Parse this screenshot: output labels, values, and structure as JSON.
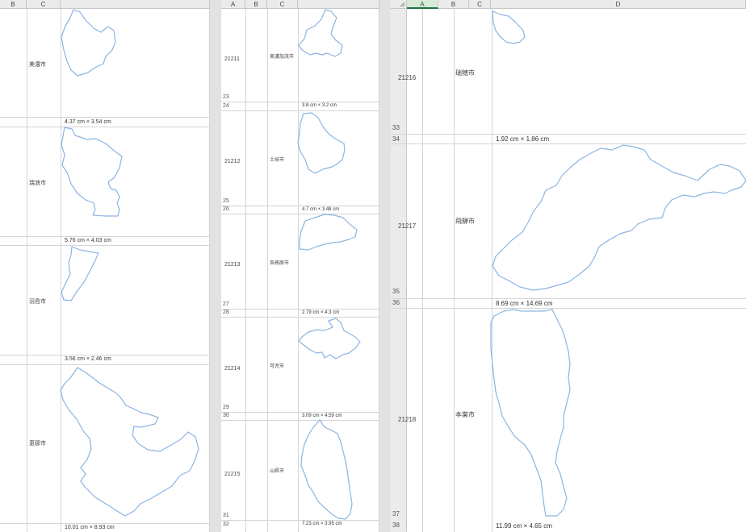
{
  "panel1": {
    "columns": [
      "B",
      "C"
    ],
    "items": [
      {
        "name": "美濃市",
        "size": "4.37 cm × 3.54 cm"
      },
      {
        "name": "瑞浪市",
        "size": "5.76 cm × 4.03 cm"
      },
      {
        "name": "羽島市",
        "size": "3.56 cm × 2.46 cm"
      },
      {
        "name": "恵那市",
        "size": "10.01 cm × 8.93 cm"
      }
    ]
  },
  "panel2": {
    "columns": [
      "A",
      "B",
      "C"
    ],
    "items": [
      {
        "code": "21211",
        "name": "美濃加茂市",
        "size": "3.8 cm × 3.2 cm",
        "row_a": "23",
        "row_b": "24"
      },
      {
        "code": "21212",
        "name": "土岐市",
        "size": "4.7 cm × 3.48 cm",
        "row_a": "25",
        "row_b": "26"
      },
      {
        "code": "21213",
        "name": "各務原市",
        "size": "2.79 cm × 4.3 cm",
        "row_a": "27",
        "row_b": "28"
      },
      {
        "code": "21214",
        "name": "可児市",
        "size": "3.09 cm × 4.59 cm",
        "row_a": "29",
        "row_b": "30"
      },
      {
        "code": "21215",
        "name": "山県市",
        "size": "7.23 cm × 3.95 cm",
        "row_a": "31",
        "row_b": "32"
      }
    ]
  },
  "panel3": {
    "columns": [
      "A",
      "B",
      "C",
      "D"
    ],
    "items": [
      {
        "code": "21216",
        "name": "瑞穂市",
        "size": "1.92 cm × 1.86 cm",
        "row_a": "33",
        "row_b": "34"
      },
      {
        "code": "21217",
        "name": "飛騨市",
        "size": "8.69 cm × 14.69 cm",
        "row_a": "35",
        "row_b": "36"
      },
      {
        "code": "21218",
        "name": "本巣市",
        "size": "11.99 cm × 4.65 cm",
        "row_a": "37",
        "row_b": "38"
      }
    ]
  }
}
